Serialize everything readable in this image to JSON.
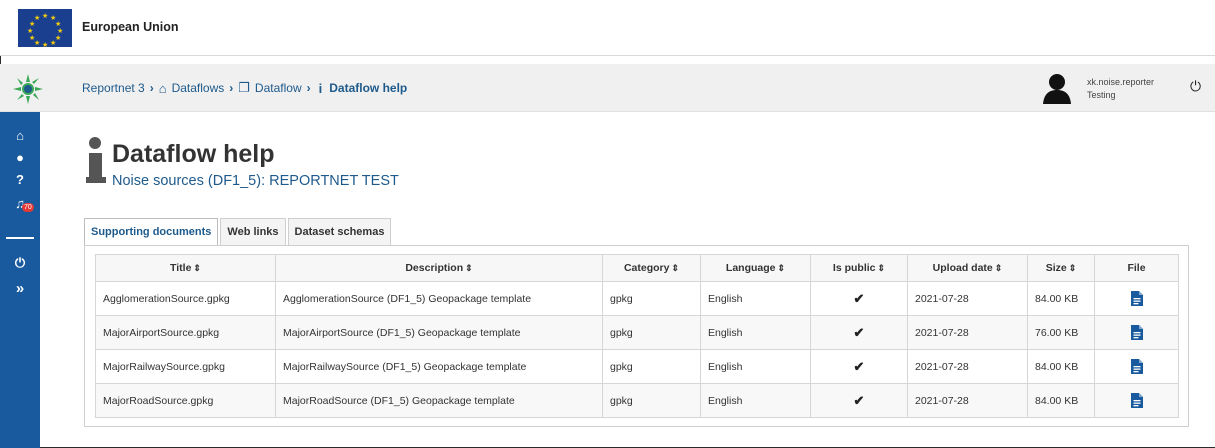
{
  "eu_bar": {
    "title": "European Union"
  },
  "header": {
    "breadcrumb": {
      "root": "Reportnet 3",
      "dataflows": "Dataflows",
      "dataflow": "Dataflow",
      "current": "Dataflow help"
    },
    "user": {
      "name": "xk.noise.reporter",
      "role": "Testing"
    }
  },
  "sidebar": {
    "notifications_count": "70"
  },
  "page": {
    "title": "Dataflow help",
    "subtitle": "Noise sources (DF1_5): REPORTNET TEST"
  },
  "tabs": [
    {
      "label": "Supporting documents",
      "active": true
    },
    {
      "label": "Web links",
      "active": false
    },
    {
      "label": "Dataset schemas",
      "active": false
    }
  ],
  "table": {
    "columns": [
      "Title",
      "Description",
      "Category",
      "Language",
      "Is public",
      "Upload date",
      "Size",
      "File"
    ],
    "rows": [
      {
        "title": "AgglomerationSource.gpkg",
        "description": "AgglomerationSource (DF1_5) Geopackage template",
        "category": "gpkg",
        "language": "English",
        "is_public": "✔",
        "upload_date": "2021-07-28",
        "size": "84.00 KB"
      },
      {
        "title": "MajorAirportSource.gpkg",
        "description": "MajorAirportSource (DF1_5) Geopackage template",
        "category": "gpkg",
        "language": "English",
        "is_public": "✔",
        "upload_date": "2021-07-28",
        "size": "76.00 KB"
      },
      {
        "title": "MajorRailwaySource.gpkg",
        "description": "MajorRailwaySource (DF1_5) Geopackage template",
        "category": "gpkg",
        "language": "English",
        "is_public": "✔",
        "upload_date": "2021-07-28",
        "size": "84.00 KB"
      },
      {
        "title": "MajorRoadSource.gpkg",
        "description": "MajorRoadSource (DF1_5) Geopackage template",
        "category": "gpkg",
        "language": "English",
        "is_public": "✔",
        "upload_date": "2021-07-28",
        "size": "84.00 KB"
      }
    ]
  },
  "colors": {
    "primary_blue": "#185a9d",
    "link_blue": "#1e5a8c",
    "eu_blue": "#1b3f8f",
    "eu_yellow": "#f2cc0c"
  }
}
